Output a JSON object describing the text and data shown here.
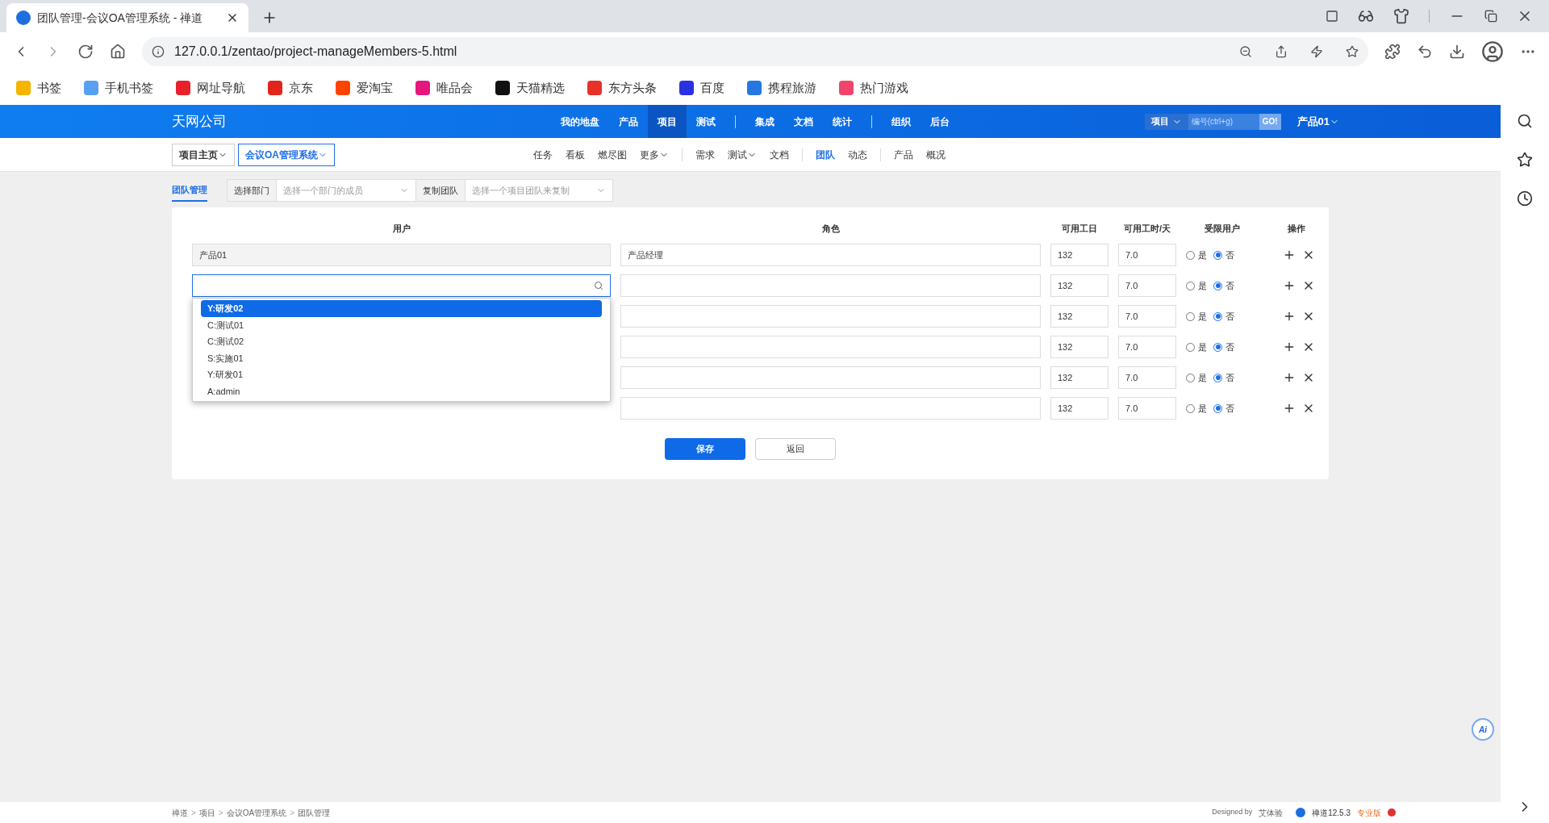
{
  "browser": {
    "tab_title": "团队管理-会议OA管理系统 - 禅道",
    "url": "127.0.0.1/zentao/project-manageMembers-5.html",
    "bookmarks": [
      {
        "label": "书签",
        "color": "#f5b400"
      },
      {
        "label": "手机书签",
        "color": "#5aa0f0"
      },
      {
        "label": "网址导航",
        "color": "#e8202a"
      },
      {
        "label": "京东",
        "color": "#e1251b"
      },
      {
        "label": "爱淘宝",
        "color": "#ff4400"
      },
      {
        "label": "唯品会",
        "color": "#e4177d"
      },
      {
        "label": "天猫精选",
        "color": "#111111"
      },
      {
        "label": "东方头条",
        "color": "#e7322a"
      },
      {
        "label": "百度",
        "color": "#2932e1"
      },
      {
        "label": "携程旅游",
        "color": "#2577e3"
      },
      {
        "label": "热门游戏",
        "color": "#f0446a"
      }
    ]
  },
  "app": {
    "company": "天网公司",
    "nav_groups": [
      [
        {
          "label": "我的地盘",
          "selected": false
        },
        {
          "label": "产品",
          "selected": false
        },
        {
          "label": "项目",
          "selected": true
        },
        {
          "label": "测试",
          "selected": false
        }
      ],
      [
        {
          "label": "集成",
          "selected": false
        },
        {
          "label": "文档",
          "selected": false
        },
        {
          "label": "统计",
          "selected": false
        }
      ],
      [
        {
          "label": "组织",
          "selected": false
        },
        {
          "label": "后台",
          "selected": false
        }
      ]
    ],
    "search": {
      "scope": "项目",
      "placeholder": "编号(ctrl+g)",
      "button": "GO!"
    },
    "user": "产品01",
    "breadcrumb": [
      {
        "label": "项目主页",
        "selected": false
      },
      {
        "label": "会议OA管理系统",
        "selected": true
      }
    ],
    "subnav_groups": [
      [
        {
          "label": "任务",
          "selected": false,
          "has_menu": false
        },
        {
          "label": "看板",
          "selected": false,
          "has_menu": false
        },
        {
          "label": "燃尽图",
          "selected": false,
          "has_menu": false
        },
        {
          "label": "更多",
          "selected": false,
          "has_menu": true
        }
      ],
      [
        {
          "label": "需求",
          "selected": false,
          "has_menu": false
        },
        {
          "label": "测试",
          "selected": false,
          "has_menu": true
        },
        {
          "label": "文档",
          "selected": false,
          "has_menu": false
        }
      ],
      [
        {
          "label": "团队",
          "selected": true,
          "has_menu": false
        },
        {
          "label": "动态",
          "selected": false,
          "has_menu": false
        }
      ],
      [
        {
          "label": "产品",
          "selected": false,
          "has_menu": false
        },
        {
          "label": "概况",
          "selected": false,
          "has_menu": false
        }
      ]
    ]
  },
  "toolbar": {
    "title": "团队管理",
    "dept_label": "选择部门",
    "dept_placeholder": "选择一个部门的成员",
    "copy_label": "复制团队",
    "copy_placeholder": "选择一个项目团队来复制"
  },
  "table": {
    "columns": [
      "用户",
      "角色",
      "可用工日",
      "可用工时/天",
      "受限用户",
      "操作"
    ],
    "rows": [
      {
        "kind": "fixed",
        "user": "产品01",
        "role": "产品经理",
        "days": "132",
        "hours": "7.0",
        "options": [
          {
            "label": "是",
            "selected": false
          },
          {
            "label": "否",
            "selected": true
          }
        ]
      },
      {
        "kind": "search",
        "role": "",
        "days": "132",
        "hours": "7.0",
        "options": [
          {
            "label": "是",
            "selected": false
          },
          {
            "label": "否",
            "selected": true
          }
        ]
      },
      {
        "kind": "covered",
        "role": "",
        "days": "132",
        "hours": "7.0",
        "options": [
          {
            "label": "是",
            "selected": false
          },
          {
            "label": "否",
            "selected": true
          }
        ]
      },
      {
        "kind": "covered",
        "role": "",
        "days": "132",
        "hours": "7.0",
        "options": [
          {
            "label": "是",
            "selected": false
          },
          {
            "label": "否",
            "selected": true
          }
        ]
      },
      {
        "kind": "covered",
        "role": "",
        "days": "132",
        "hours": "7.0",
        "options": [
          {
            "label": "是",
            "selected": false
          },
          {
            "label": "否",
            "selected": true
          }
        ]
      },
      {
        "kind": "covered",
        "role": "",
        "days": "132",
        "hours": "7.0",
        "options": [
          {
            "label": "是",
            "selected": false
          },
          {
            "label": "否",
            "selected": true
          }
        ]
      }
    ],
    "dropdown": [
      {
        "label": "Y:研发02",
        "selected": true
      },
      {
        "label": "C:测试01",
        "selected": false
      },
      {
        "label": "C:测试02",
        "selected": false
      },
      {
        "label": "S:实施01",
        "selected": false
      },
      {
        "label": "Y:研发01",
        "selected": false
      },
      {
        "label": "A:admin",
        "selected": false
      }
    ]
  },
  "buttons": {
    "save": "保存",
    "back": "返回"
  },
  "footer": {
    "crumbs": [
      "禅道",
      "项目",
      "会议OA管理系统",
      "团队管理"
    ],
    "separator": ">",
    "designed_by": "Designed by",
    "designer": "艾体验",
    "version": "禅道12.5.3",
    "edition": "专业版"
  },
  "assistant": "Ai"
}
